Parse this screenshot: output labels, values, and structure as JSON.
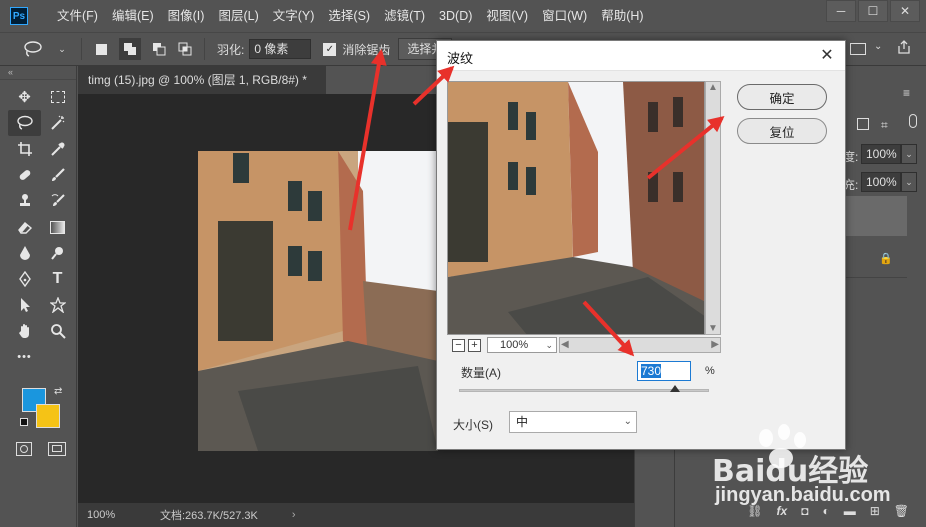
{
  "app": {
    "logo": "Ps"
  },
  "menu": [
    "文件(F)",
    "编辑(E)",
    "图像(I)",
    "图层(L)",
    "文字(Y)",
    "选择(S)",
    "滤镜(T)",
    "3D(D)",
    "视图(V)",
    "窗口(W)",
    "帮助(H)"
  ],
  "window_controls": {
    "minimize": "─",
    "maximize": "☐",
    "close": "✕"
  },
  "options": {
    "feather_label": "羽化:",
    "feather_value": "0 像素",
    "antialias_label": "消除锯齿",
    "antialias_checked": true,
    "select_mask": "选择并"
  },
  "toolbar": {
    "collapse": "«",
    "more": "•••"
  },
  "colors": {
    "foreground": "#1a96de",
    "background": "#f5c316",
    "accent": "#1c7ad3",
    "arrow": "#e8312b"
  },
  "document": {
    "tab": "timg (15).jpg @ 100% (图层 1, RGB/8#) *",
    "zoom": "100%",
    "doc_size": "文档:263.7K/527.3K",
    "status_arrow": "›"
  },
  "panels": {
    "opacity_label": "度:",
    "opacity_value": "100%",
    "fill_label": "充:",
    "fill_value": "100%"
  },
  "dialog": {
    "title": "波纹",
    "ok": "确定",
    "reset": "复位",
    "zoom_value": "100%",
    "amount_label": "数量(A)",
    "amount_value": "730",
    "amount_unit": "%",
    "amount_fraction": 0.865,
    "size_label": "大小(S)",
    "size_value": "中"
  },
  "watermark": {
    "brand": "Baidu经验",
    "url": "jingyan.baidu.com"
  }
}
